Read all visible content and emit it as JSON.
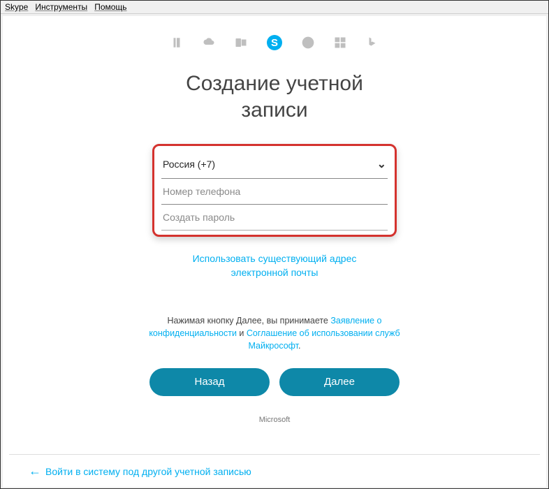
{
  "menubar": {
    "skype": "Skype",
    "tools": "Инструменты",
    "help": "Помощь"
  },
  "icons": {
    "office": "office-icon",
    "onedrive": "onedrive-icon",
    "outlook": "outlook-icon",
    "skype": "skype-icon",
    "xbox": "xbox-icon",
    "windows": "windows-icon",
    "bing": "bing-icon"
  },
  "title_line1": "Создание учетной",
  "title_line2": "записи",
  "form": {
    "country_value": "Россия (+7)",
    "phone_placeholder": "Номер телефона",
    "password_placeholder": "Создать пароль"
  },
  "use_email_link_line1": "Использовать существующий адрес",
  "use_email_link_line2": "электронной почты",
  "terms": {
    "prefix": "Нажимая кнопку Далее, вы принимаете ",
    "privacy_link": "Заявление о конфиденциальности",
    "and": " и ",
    "tos_link": "Соглашение об использовании служб Майкрософт",
    "suffix": "."
  },
  "buttons": {
    "back": "Назад",
    "next": "Далее"
  },
  "footer": "Microsoft",
  "bottom_link": "Войти в систему под другой учетной записью"
}
